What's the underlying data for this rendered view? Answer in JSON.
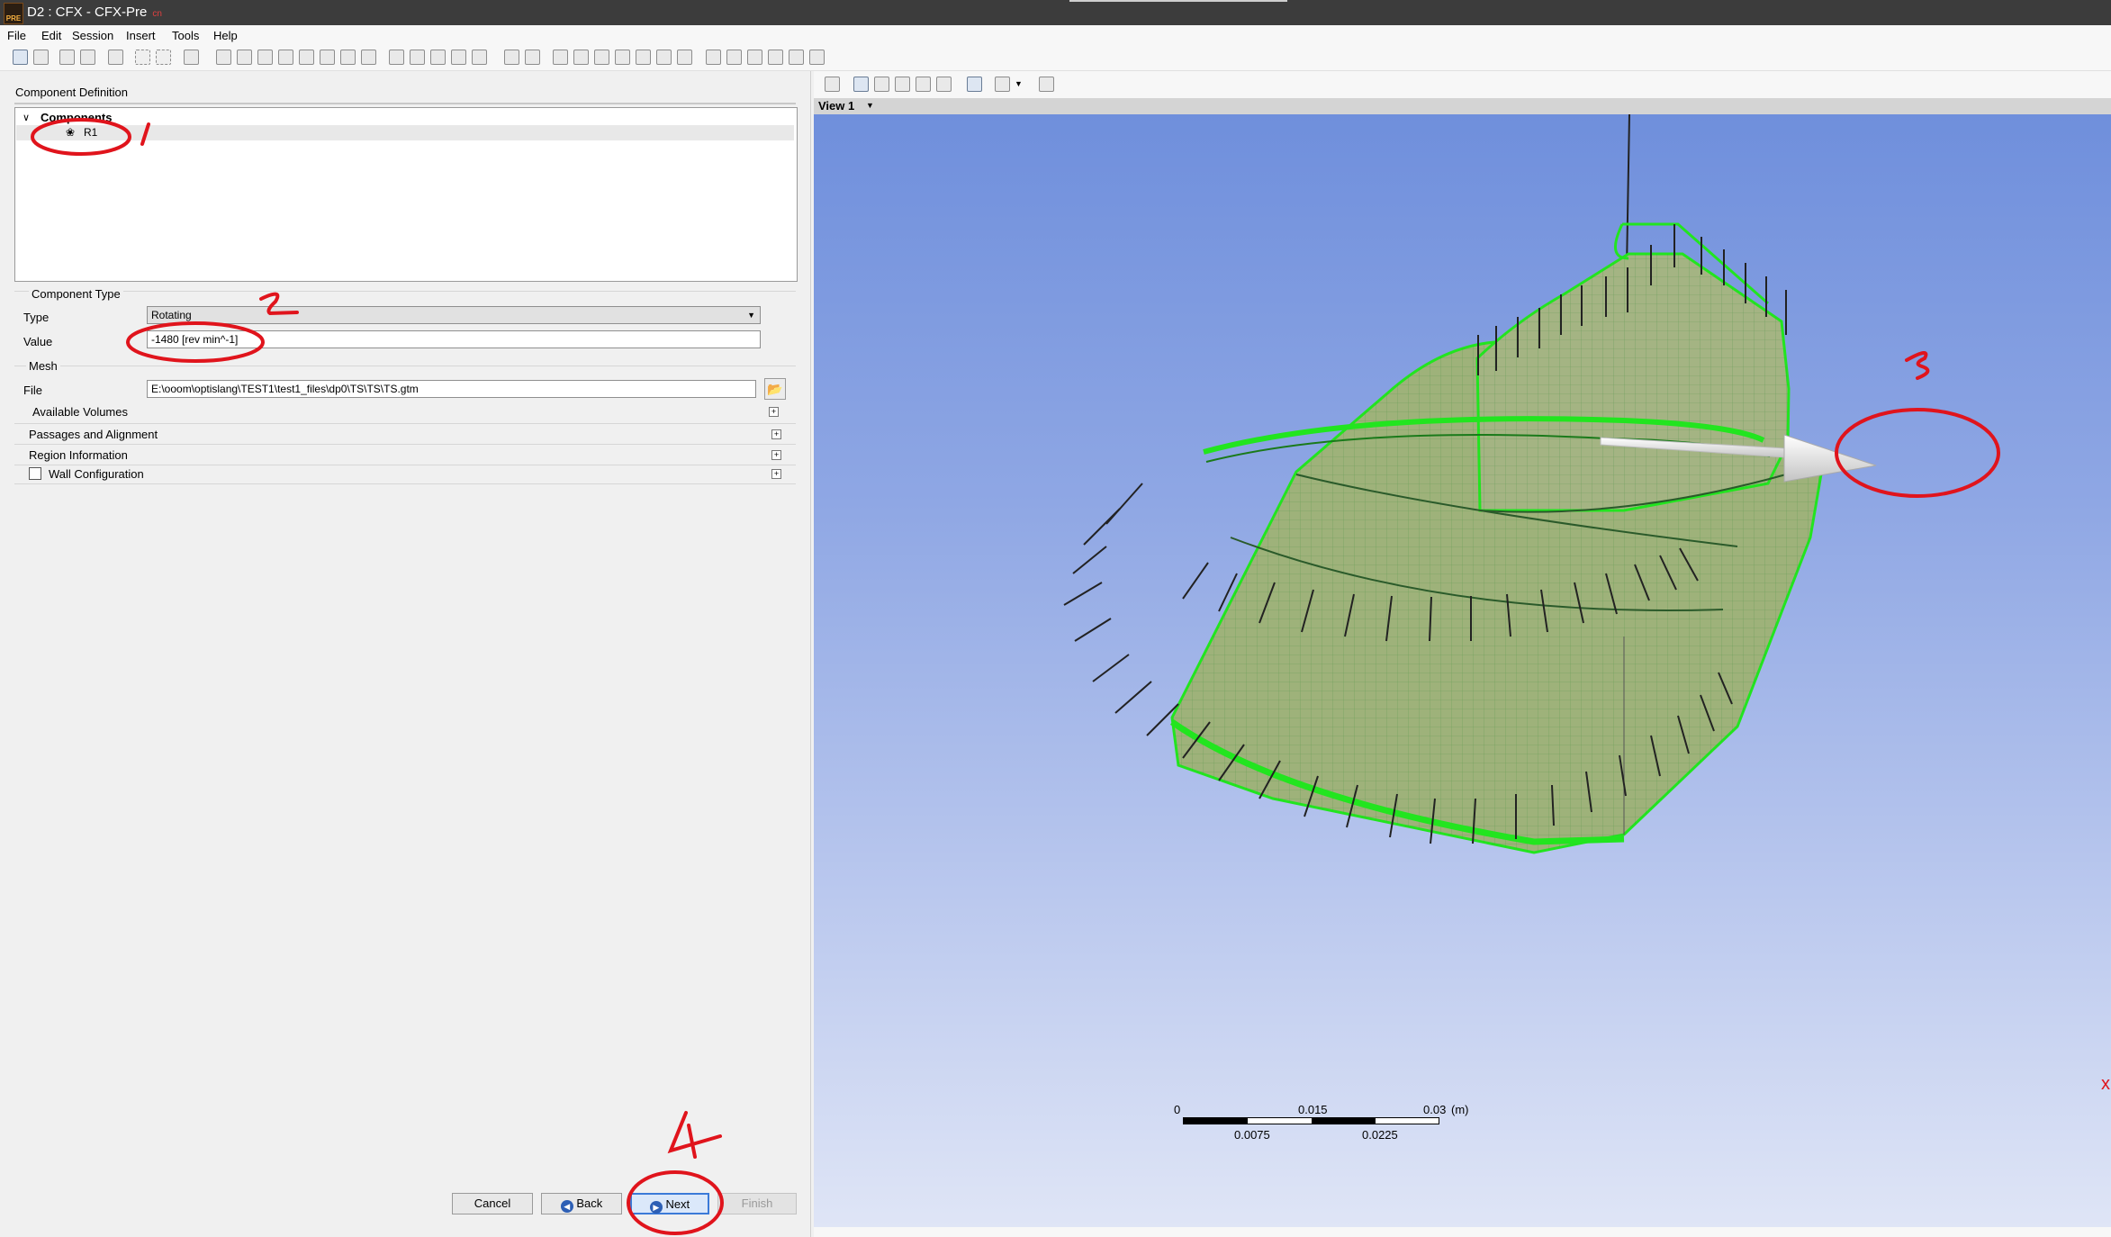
{
  "window": {
    "title": "D2 : CFX - CFX-Pre",
    "subtitle": "cn",
    "logo_text": "PRE"
  },
  "menu": [
    "File",
    "Edit",
    "Session",
    "Insert",
    "Tools",
    "Help"
  ],
  "left": {
    "section_title": "Component Definition",
    "tree": {
      "header": "Components",
      "items": [
        "R1"
      ]
    },
    "component_type": {
      "title": "Component Type",
      "type_label": "Type",
      "type_value": "Rotating",
      "value_label": "Value",
      "value_value": "-1480 [rev min^-1]"
    },
    "mesh": {
      "title": "Mesh",
      "file_label": "File",
      "file_value": "E:\\ooom\\optislang\\TEST1\\test1_files\\dp0\\TS\\TS\\TS.gtm",
      "available_volumes": "Available Volumes"
    },
    "sections": [
      "Passages and Alignment",
      "Region Information",
      "Wall Configuration"
    ],
    "buttons": {
      "cancel": "Cancel",
      "back": "Back",
      "next": "Next",
      "finish": "Finish"
    }
  },
  "viewer": {
    "view_label": "View 1",
    "scale": {
      "ticks_top": [
        "0",
        "0.015",
        "0.03"
      ],
      "ticks_bottom": [
        "0.0075",
        "0.0225"
      ],
      "unit": "(m)"
    }
  },
  "annotations": [
    "1",
    "2",
    "3",
    "4"
  ],
  "colors": {
    "mesh_green": "#22e51f",
    "annotation_red": "#e0141c",
    "titlebar": "#3c3c3c"
  }
}
